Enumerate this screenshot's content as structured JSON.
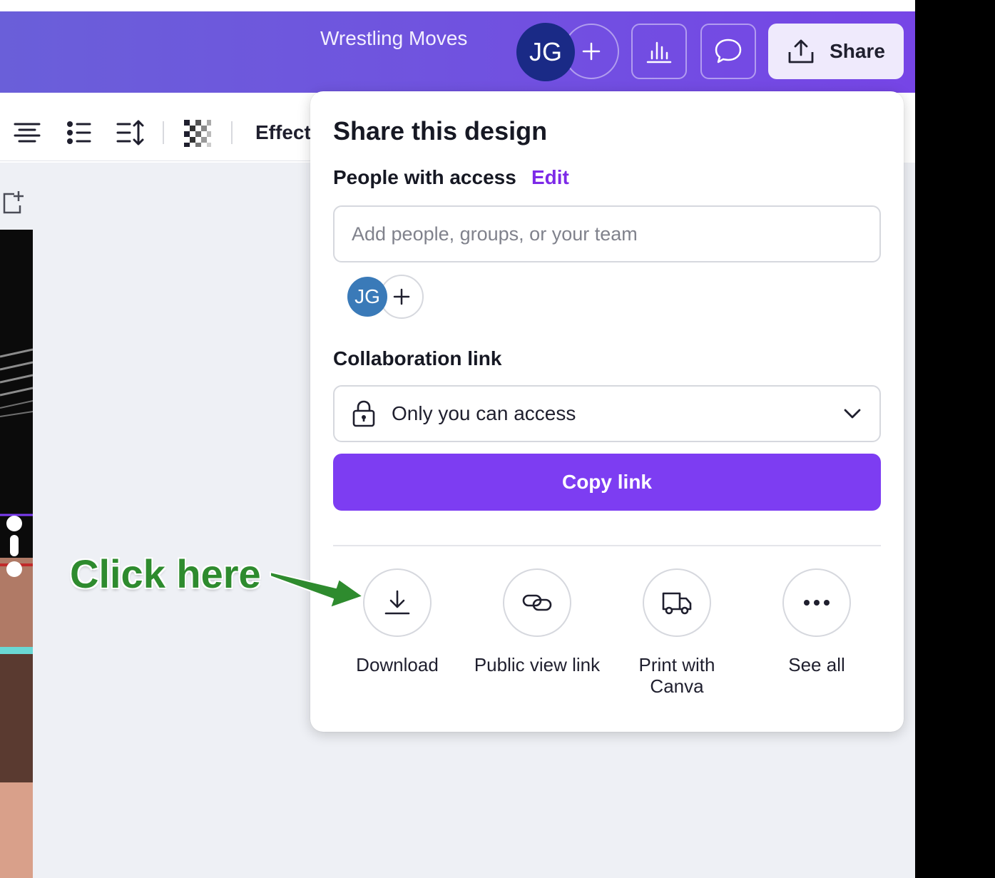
{
  "header": {
    "doc_title": "Wrestling Moves",
    "avatar_initials": "JG",
    "share_label": "Share",
    "accent_color": "#7d3df2"
  },
  "toolbar": {
    "effects_label": "Effect",
    "icons": [
      "align-center-icon",
      "bulleted-list-icon",
      "line-spacing-icon",
      "transparency-icon"
    ]
  },
  "share_panel": {
    "title": "Share this design",
    "people_label": "People with access",
    "edit_label": "Edit",
    "add_people_placeholder": "Add people, groups, or your team",
    "member_initials": "JG",
    "collab_link_label": "Collaboration link",
    "access_value": "Only you can access",
    "copy_link_label": "Copy link",
    "actions": [
      {
        "label": "Download",
        "icon": "download-icon"
      },
      {
        "label": "Public view link",
        "icon": "link-icon"
      },
      {
        "label": "Print with Canva",
        "icon": "truck-icon"
      },
      {
        "label": "See all",
        "icon": "more-icon"
      }
    ]
  },
  "annotation": {
    "text": "Click here",
    "color": "#2e8b2e"
  }
}
